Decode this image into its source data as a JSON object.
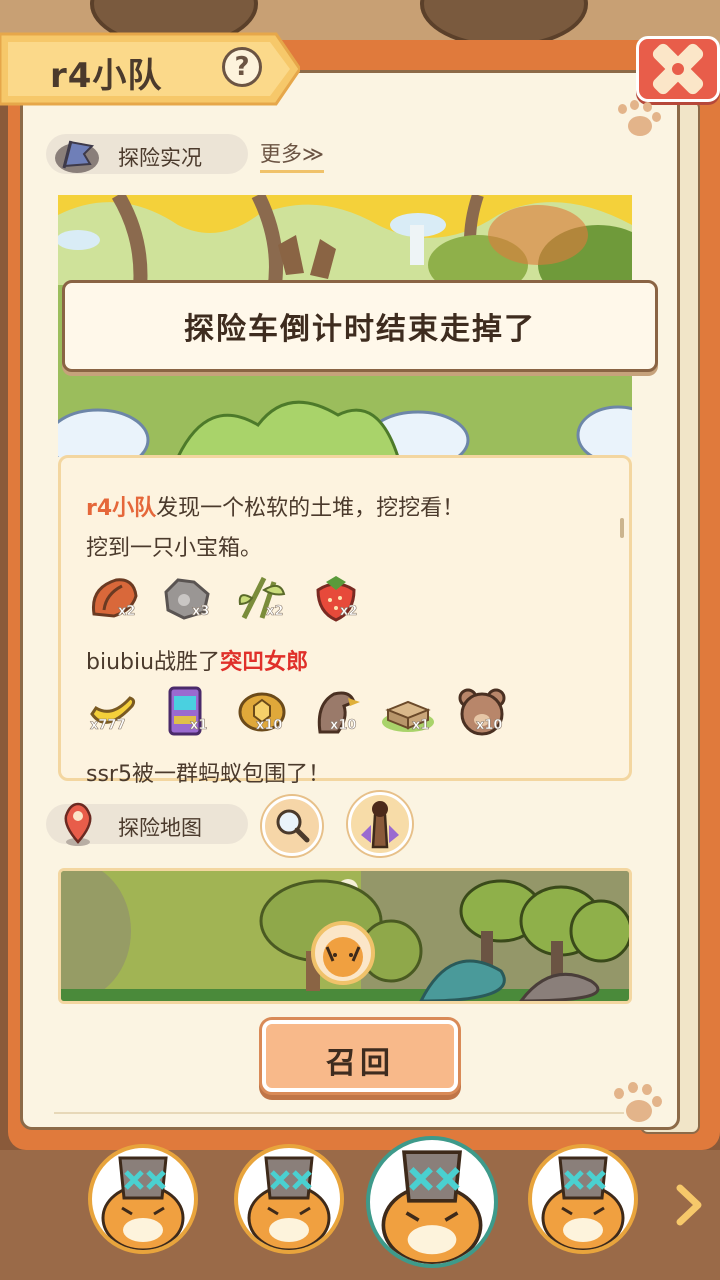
{
  "header": {
    "team_name": "r4小队",
    "help_symbol": "?"
  },
  "expedition_live": {
    "label": "探险实况",
    "more_label": "更多≫"
  },
  "toast": {
    "message": "探险车倒计时结束走掉了"
  },
  "log": {
    "lines": [
      {
        "team": "r4小队",
        "text": "发现一个松软的土堆，挖挖看！"
      },
      {
        "text": "挖到一只小宝箱。"
      },
      {
        "player": "biubiu",
        "action": "战胜了",
        "enemy": "突凹女郎"
      },
      {
        "text": "ssr5被一群蚂蚁包围了！"
      }
    ],
    "loot_row_1": [
      {
        "icon": "walnut-icon",
        "qty": "x2"
      },
      {
        "icon": "stone-icon",
        "qty": "x3"
      },
      {
        "icon": "bamboo-icon",
        "qty": "x2"
      },
      {
        "icon": "strawberry-icon",
        "qty": "x2"
      }
    ],
    "loot_row_2": [
      {
        "icon": "banana-icon",
        "qty": "x777"
      },
      {
        "icon": "arcade-machine-icon",
        "qty": "x1"
      },
      {
        "icon": "turtle-shell-icon",
        "qty": "x10"
      },
      {
        "icon": "eagle-icon",
        "qty": "x10"
      },
      {
        "icon": "box-icon",
        "qty": "x1"
      },
      {
        "icon": "bear-badge-icon",
        "qty": "x10"
      }
    ]
  },
  "expedition_map": {
    "label": "探险地图"
  },
  "actions": {
    "recall_label": "召回"
  },
  "colors": {
    "book_orange": "#e07a3c",
    "page": "#fbf4e2",
    "highlight_orange": "#e5673a",
    "highlight_red": "#e0302a",
    "close_red": "#e85d4a"
  }
}
